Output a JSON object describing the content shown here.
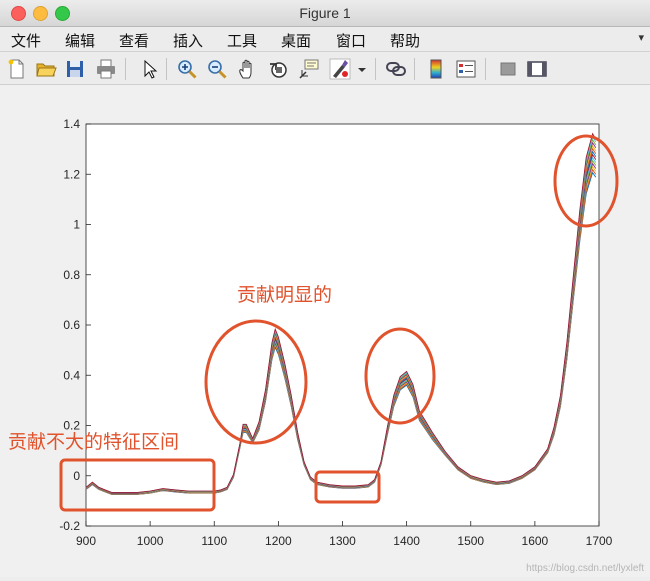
{
  "window": {
    "title": "Figure 1"
  },
  "menu": [
    "文件",
    "编辑",
    "查看",
    "插入",
    "工具",
    "桌面",
    "窗口",
    "帮助"
  ],
  "menu_overflow": "▾",
  "toolbar": [
    "new-icon",
    "open-icon",
    "save-icon",
    "print-icon",
    "pointer-icon",
    "zoom-in-icon",
    "zoom-out-icon",
    "pan-icon",
    "rotate-icon",
    "data-cursor-icon",
    "brush-icon",
    "brush-dropdown-icon",
    "link-icon",
    "colorbar-icon",
    "legend-icon",
    "hide-plot-tools-icon",
    "show-plot-tools-icon"
  ],
  "annotations": {
    "significant": "贡献明显的",
    "insignificant": "贡献不大的特征区间"
  },
  "watermark": "https://blog.csdn.net/lyxleft",
  "accent_color": "#e0532c",
  "chart_data": {
    "type": "line",
    "xlim": [
      900,
      1700
    ],
    "ylim": [
      -0.2,
      1.4
    ],
    "xticks": [
      "900",
      "1000",
      "1100",
      "1200",
      "1300",
      "1400",
      "1500",
      "1600",
      "1700"
    ],
    "yticks": [
      "-0.2",
      "0",
      "0.2",
      "0.4",
      "0.6",
      "0.8",
      "1",
      "1.2",
      "1.4"
    ],
    "grid": false,
    "x": [
      900,
      910,
      920,
      930,
      940,
      960,
      980,
      1000,
      1020,
      1040,
      1060,
      1080,
      1100,
      1110,
      1120,
      1130,
      1140,
      1145,
      1150,
      1160,
      1170,
      1180,
      1190,
      1195,
      1200,
      1210,
      1220,
      1230,
      1240,
      1250,
      1260,
      1280,
      1300,
      1320,
      1340,
      1350,
      1360,
      1370,
      1380,
      1390,
      1400,
      1410,
      1420,
      1430,
      1440,
      1460,
      1480,
      1500,
      1520,
      1540,
      1560,
      1580,
      1600,
      1620,
      1630,
      1640,
      1650,
      1660,
      1670,
      1680,
      1690,
      1695
    ],
    "series": [
      {
        "values": [
          -0.05,
          -0.03,
          -0.05,
          -0.06,
          -0.07,
          -0.07,
          -0.07,
          -0.065,
          -0.055,
          -0.06,
          -0.065,
          -0.065,
          -0.065,
          -0.06,
          -0.05,
          0.0,
          0.12,
          0.19,
          0.19,
          0.14,
          0.2,
          0.32,
          0.5,
          0.55,
          0.52,
          0.42,
          0.3,
          0.16,
          0.05,
          -0.01,
          -0.03,
          -0.04,
          -0.045,
          -0.045,
          -0.04,
          -0.02,
          0.05,
          0.18,
          0.3,
          0.37,
          0.39,
          0.34,
          0.24,
          0.2,
          0.16,
          0.09,
          0.03,
          -0.005,
          -0.02,
          -0.03,
          -0.025,
          -0.005,
          0.03,
          0.1,
          0.18,
          0.3,
          0.5,
          0.75,
          1.0,
          1.2,
          1.29,
          1.27
        ]
      }
    ]
  }
}
